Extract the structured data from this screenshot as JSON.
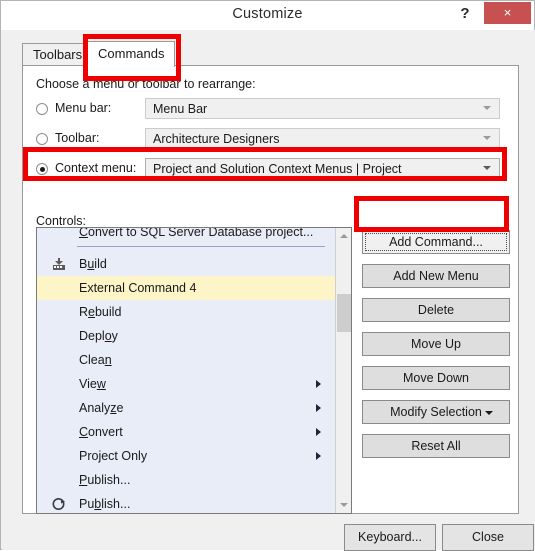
{
  "window": {
    "title": "Customize",
    "help_label": "?",
    "close_label": "×"
  },
  "tabs": [
    {
      "id": "toolbars",
      "label": "Toolbars",
      "selected": false
    },
    {
      "id": "commands",
      "label": "Commands",
      "selected": true
    }
  ],
  "labels": {
    "choose": "Choose a menu or toolbar to rearrange:",
    "controls": "Controls:"
  },
  "radios": [
    {
      "id": "menu-bar",
      "label": "Menu bar:",
      "checked": false
    },
    {
      "id": "toolbar",
      "label": "Toolbar:",
      "checked": false
    },
    {
      "id": "context-menu",
      "label": "Context menu:",
      "checked": true
    }
  ],
  "combos": [
    {
      "id": "menu-bar",
      "value": "Menu Bar",
      "enabled": false
    },
    {
      "id": "toolbar",
      "value": "Architecture Designers",
      "enabled": false
    },
    {
      "id": "context-menu",
      "value": "Project and Solution Context Menus | Project",
      "enabled": true
    }
  ],
  "controls_list": {
    "items": [
      {
        "label": "Convert to SQL Server Database project...",
        "mnemonic": "C",
        "icon": null,
        "submenu": false,
        "highlight": false,
        "clipped": true
      },
      {
        "label": "",
        "separator": true
      },
      {
        "label": "Build",
        "mnemonic": "u",
        "icon": "build-icon",
        "submenu": false,
        "highlight": false
      },
      {
        "label": "External Command 4",
        "mnemonic": null,
        "icon": null,
        "submenu": false,
        "highlight": true
      },
      {
        "label": "Rebuild",
        "mnemonic": "e",
        "icon": null,
        "submenu": false,
        "highlight": false
      },
      {
        "label": "Deploy",
        "mnemonic": "o",
        "icon": null,
        "submenu": false,
        "highlight": false
      },
      {
        "label": "Clean",
        "mnemonic": "n",
        "icon": null,
        "submenu": false,
        "highlight": false
      },
      {
        "label": "View",
        "mnemonic": "w",
        "icon": null,
        "submenu": true,
        "highlight": false
      },
      {
        "label": "Analyze",
        "mnemonic": "z",
        "icon": null,
        "submenu": true,
        "highlight": false
      },
      {
        "label": "Convert",
        "mnemonic": "C",
        "icon": null,
        "submenu": true,
        "highlight": false
      },
      {
        "label": "Project Only",
        "mnemonic": null,
        "icon": null,
        "submenu": true,
        "highlight": false
      },
      {
        "label": "Publish...",
        "mnemonic": "P",
        "icon": null,
        "submenu": false,
        "highlight": false
      },
      {
        "label": "Publish...",
        "mnemonic": "b",
        "icon": "publish-icon",
        "submenu": false,
        "highlight": false
      }
    ],
    "scrollbar": {
      "up_icon": "chevron-up-icon",
      "down_icon": "chevron-down-icon"
    }
  },
  "side_buttons": [
    {
      "id": "add-command",
      "label": "Add Command...",
      "focused": true,
      "caret": false
    },
    {
      "id": "add-new-menu",
      "label": "Add New Menu",
      "focused": false,
      "caret": false
    },
    {
      "id": "delete",
      "label": "Delete",
      "focused": false,
      "caret": false
    },
    {
      "id": "move-up",
      "label": "Move Up",
      "focused": false,
      "caret": false
    },
    {
      "id": "move-down",
      "label": "Move Down",
      "focused": false,
      "caret": false
    },
    {
      "id": "modify-selection",
      "label": "Modify Selection",
      "focused": false,
      "caret": true
    },
    {
      "id": "reset-all",
      "label": "Reset All",
      "focused": false,
      "caret": false
    }
  ],
  "bottom_buttons": [
    {
      "id": "keyboard",
      "label": "Keyboard..."
    },
    {
      "id": "close",
      "label": "Close"
    }
  ],
  "annotations": {
    "color": "#ef0000",
    "targets": [
      "commands-tab",
      "context-menu-row",
      "add-command-button"
    ]
  }
}
